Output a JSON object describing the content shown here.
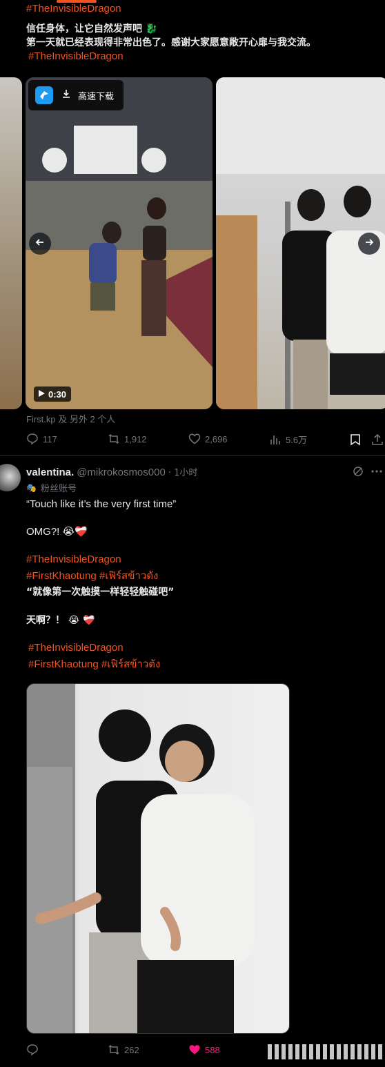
{
  "post1": {
    "hashtag_top": "#TheInvisibleDragon",
    "line1": "信任身体，让它自然发声吧 🐉",
    "line2": "第一天就已经表现得非常出色了。感谢大家愿意敞开心扉与我交流。",
    "hashtag": "#TheInvisibleDragon",
    "download_label": "高速下载",
    "video_duration": "0:30",
    "tagged": "First.kp 及 另外 2 个人",
    "actions": {
      "replies": "117",
      "reposts": "1,912",
      "likes": "2,696",
      "views": "5.6万"
    }
  },
  "post2": {
    "display_name": "valentina.",
    "handle": "@mikrokosmos000",
    "time": "· 1小时",
    "fan_badge": "粉丝账号",
    "quote_en": "“Touch like it’s the very first time”",
    "omg_en": "OMG?! 😭❤️‍🩹",
    "hashtag1": "#TheInvisibleDragon",
    "hashtag2": "#FirstKhaotung #เฟิร์สข้าวตัง",
    "quote_cn": "“就像第一次触摸一样轻轻触碰吧”",
    "omg_cn": "天啊？！ 😭 ❤️‍🩹",
    "hashtag3": "#TheInvisibleDragon",
    "hashtag4": "#FirstKhaotung #เฟิร์สข้าวตัง",
    "actions": {
      "reposts": "262",
      "likes": "588"
    }
  },
  "colors": {
    "accent": "#f4511e",
    "like_pink": "#f91880",
    "muted": "#71767b"
  }
}
